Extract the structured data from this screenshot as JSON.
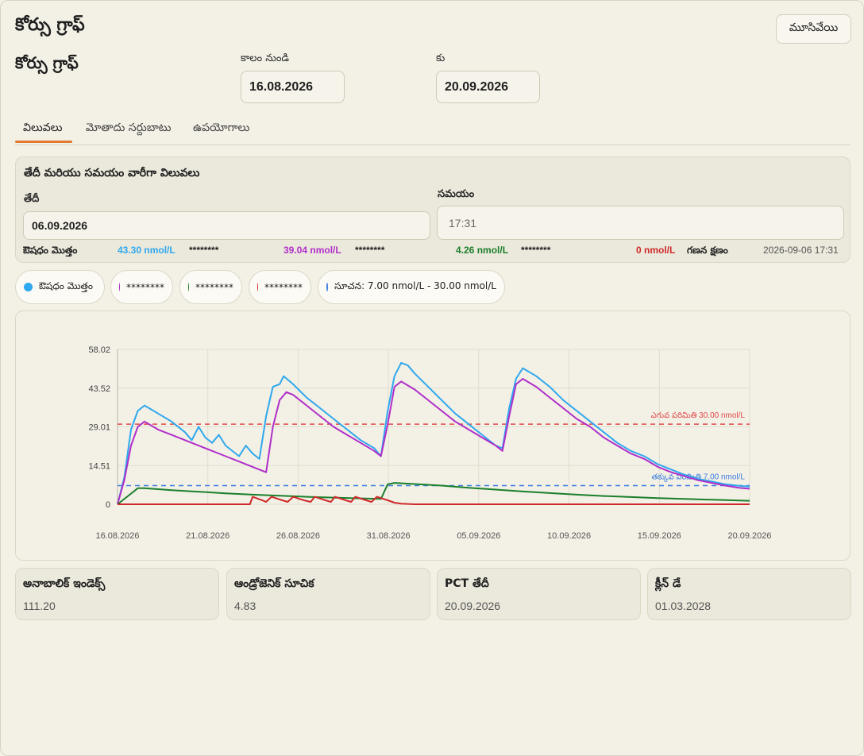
{
  "window": {
    "title": "కోర్సు గ్రాఫ్",
    "close_label": "మూసివేయి"
  },
  "header": {
    "subtitle": "కోర్సు గ్రాఫ్",
    "period_from_label": "కాలం నుండి",
    "period_from_value": "16.08.2026",
    "period_to_label": "కు",
    "period_to_value": "20.09.2026"
  },
  "tabs": [
    {
      "label": "విలువలు",
      "active": true
    },
    {
      "label": "మోతాదు సర్దుబాటు",
      "active": false
    },
    {
      "label": "ఉపయోగాలు",
      "active": false
    }
  ],
  "values_panel": {
    "title": "తేదీ మరియు సమయం వారీగా విలువలు",
    "date_label": "తేదీ",
    "date_value": "06.09.2026",
    "time_label": "సమయం",
    "time_value": "17:31",
    "total_label": "ఔషధం మొత్తం",
    "total_value": "43.30 nmol/L",
    "series2_value": "39.04 nmol/L",
    "series3_value": "4.26 nmol/L",
    "series4_value": "0 nmol/L",
    "masked": "********",
    "calc_label": "గణన క్షణం",
    "calc_value": "2026-09-06 17:31"
  },
  "legend": [
    {
      "label": "ఔషధం మొత్తం",
      "color": "#2ea8ee"
    },
    {
      "label": "********",
      "color": "#b02fc9"
    },
    {
      "label": "********",
      "color": "#1a7f2a"
    },
    {
      "label": "********",
      "color": "#cf2a2a"
    },
    {
      "label": "సూచన: 7.00 nmol/L - 30.00 nmol/L",
      "color": "#3a7de0"
    }
  ],
  "chart_data": {
    "type": "line",
    "x_start": "16.08.2026",
    "x_end": "20.09.2026",
    "x_ticks": [
      "16.08.2026",
      "21.08.2026",
      "26.08.2026",
      "31.08.2026",
      "05.09.2026",
      "10.09.2026",
      "15.09.2026",
      "20.09.2026"
    ],
    "y_ticks": [
      "0",
      "14.51",
      "29.01",
      "43.52",
      "58.02"
    ],
    "ylim": [
      0,
      58.02
    ],
    "grid": true,
    "reference_lines": [
      {
        "label": "ఎగువ పరిమితి 30.00 nmol/L",
        "value": 30.0,
        "color": "#e04848"
      },
      {
        "label": "తక్కువ పరిమితి 7.00 nmol/L",
        "value": 7.0,
        "color": "#3a7de0"
      }
    ],
    "series": [
      {
        "color": "#2ea8ee",
        "points": [
          [
            0,
            0
          ],
          [
            0.5,
            10
          ],
          [
            1,
            28
          ],
          [
            1.5,
            35
          ],
          [
            2,
            37
          ],
          [
            3,
            34
          ],
          [
            4,
            31
          ],
          [
            5,
            27
          ],
          [
            5.5,
            24
          ],
          [
            6,
            29
          ],
          [
            6.5,
            25
          ],
          [
            7,
            23
          ],
          [
            7.5,
            26
          ],
          [
            8,
            22
          ],
          [
            9,
            18
          ],
          [
            9.5,
            22
          ],
          [
            10,
            19
          ],
          [
            10.5,
            17
          ],
          [
            11,
            33
          ],
          [
            11.5,
            44
          ],
          [
            12,
            45
          ],
          [
            12.3,
            48
          ],
          [
            13,
            45
          ],
          [
            14,
            40
          ],
          [
            15,
            36
          ],
          [
            16,
            32
          ],
          [
            17,
            28
          ],
          [
            18,
            24
          ],
          [
            19,
            21
          ],
          [
            19.5,
            18
          ],
          [
            20,
            35
          ],
          [
            20.5,
            48
          ],
          [
            21,
            53
          ],
          [
            21.5,
            52
          ],
          [
            22,
            49
          ],
          [
            23,
            44
          ],
          [
            24,
            39
          ],
          [
            25,
            34
          ],
          [
            26,
            30
          ],
          [
            27,
            26
          ],
          [
            28,
            22
          ],
          [
            28.5,
            21
          ],
          [
            29,
            36
          ],
          [
            29.5,
            47
          ],
          [
            30,
            51
          ],
          [
            31,
            48
          ],
          [
            32,
            44
          ],
          [
            33,
            39
          ],
          [
            34,
            35
          ],
          [
            35,
            31
          ],
          [
            36,
            27
          ],
          [
            37,
            23
          ],
          [
            38,
            20
          ],
          [
            39,
            18
          ],
          [
            40,
            15
          ],
          [
            41,
            13
          ],
          [
            42,
            11
          ],
          [
            43,
            9.5
          ],
          [
            44,
            8.5
          ],
          [
            45,
            7.5
          ],
          [
            46,
            6.9
          ],
          [
            46.8,
            6.6
          ]
        ]
      },
      {
        "color": "#b02fc9",
        "points": [
          [
            0,
            0
          ],
          [
            0.5,
            9
          ],
          [
            1,
            22
          ],
          [
            1.5,
            29
          ],
          [
            2,
            31
          ],
          [
            3,
            28
          ],
          [
            4,
            26
          ],
          [
            5,
            24
          ],
          [
            6,
            22
          ],
          [
            7,
            20
          ],
          [
            8,
            18
          ],
          [
            9,
            16
          ],
          [
            10,
            14
          ],
          [
            11,
            12
          ],
          [
            11.5,
            29
          ],
          [
            12,
            39
          ],
          [
            12.5,
            42
          ],
          [
            13,
            41
          ],
          [
            14,
            37
          ],
          [
            15,
            33
          ],
          [
            16,
            29
          ],
          [
            17,
            26
          ],
          [
            18,
            23
          ],
          [
            19,
            20
          ],
          [
            19.5,
            18
          ],
          [
            20,
            30
          ],
          [
            20.5,
            44
          ],
          [
            21,
            46
          ],
          [
            22,
            43
          ],
          [
            23,
            39
          ],
          [
            24,
            35
          ],
          [
            25,
            31
          ],
          [
            26,
            28
          ],
          [
            27,
            25
          ],
          [
            28,
            22
          ],
          [
            28.5,
            20
          ],
          [
            29,
            33
          ],
          [
            29.5,
            45
          ],
          [
            30,
            47
          ],
          [
            31,
            44
          ],
          [
            32,
            40
          ],
          [
            33,
            36
          ],
          [
            34,
            32
          ],
          [
            35,
            29
          ],
          [
            36,
            25
          ],
          [
            37,
            22
          ],
          [
            38,
            19
          ],
          [
            39,
            17
          ],
          [
            40,
            14
          ],
          [
            41,
            12
          ],
          [
            42,
            10.5
          ],
          [
            43,
            9
          ],
          [
            44,
            8
          ],
          [
            45,
            7
          ],
          [
            46,
            6.2
          ],
          [
            46.8,
            5.8
          ]
        ]
      },
      {
        "color": "#1a7f2a",
        "points": [
          [
            0,
            0
          ],
          [
            1,
            4
          ],
          [
            1.5,
            6
          ],
          [
            2,
            6
          ],
          [
            4,
            5.3
          ],
          [
            6,
            4.7
          ],
          [
            8,
            4.1
          ],
          [
            10,
            3.6
          ],
          [
            12,
            3.2
          ],
          [
            14,
            2.8
          ],
          [
            16,
            2.5
          ],
          [
            18,
            2.2
          ],
          [
            19.5,
            2.0
          ],
          [
            20,
            7.5
          ],
          [
            20.5,
            8
          ],
          [
            22,
            7.6
          ],
          [
            24,
            7
          ],
          [
            26,
            6.2
          ],
          [
            28,
            5.5
          ],
          [
            30,
            4.8
          ],
          [
            32,
            4.2
          ],
          [
            34,
            3.6
          ],
          [
            36,
            3.1
          ],
          [
            38,
            2.7
          ],
          [
            40,
            2.3
          ],
          [
            42,
            2.0
          ],
          [
            44,
            1.7
          ],
          [
            46.8,
            1.3
          ]
        ]
      },
      {
        "color": "#cf2a2a",
        "points": [
          [
            0,
            0
          ],
          [
            9.8,
            0
          ],
          [
            10,
            2.8
          ],
          [
            10.8,
            1.3
          ],
          [
            11,
            0.9
          ],
          [
            11.4,
            2.8
          ],
          [
            12.2,
            1.5
          ],
          [
            12.6,
            0.9
          ],
          [
            13,
            2.8
          ],
          [
            13.8,
            1.5
          ],
          [
            14.3,
            0.9
          ],
          [
            14.6,
            2.8
          ],
          [
            15.4,
            1.5
          ],
          [
            15.8,
            0.9
          ],
          [
            16.1,
            2.8
          ],
          [
            16.9,
            1.5
          ],
          [
            17.3,
            0.9
          ],
          [
            17.6,
            2.8
          ],
          [
            18.4,
            1.5
          ],
          [
            18.8,
            0.9
          ],
          [
            19.2,
            2.8
          ],
          [
            20,
            1.5
          ],
          [
            20.5,
            0.6
          ],
          [
            21,
            0.2
          ],
          [
            22,
            0
          ],
          [
            46.8,
            0
          ]
        ]
      }
    ]
  },
  "cards": [
    {
      "label": "అనాబాలిక్ ఇండెక్స్",
      "value": "111.20"
    },
    {
      "label": "ఆండ్రోజెనిక్ సూచిక",
      "value": "4.83"
    },
    {
      "label": "PCT తేదీ",
      "value": "20.09.2026"
    },
    {
      "label": "క్లీన్ డే",
      "value": "01.03.2028"
    }
  ]
}
